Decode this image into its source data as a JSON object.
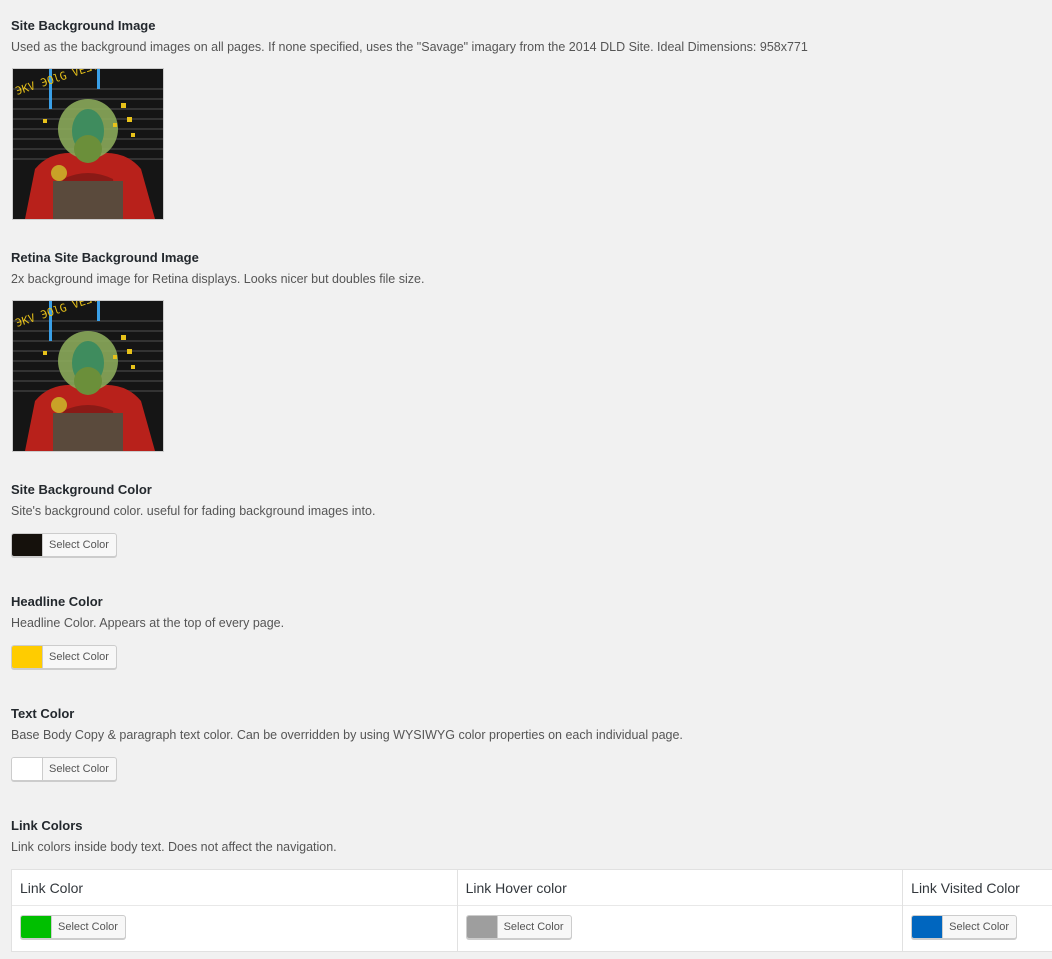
{
  "site_bg_image": {
    "title": "Site Background Image",
    "description": "Used as the background images on all pages. If none specified, uses the \"Savage\" imagary from the 2014 DLD Site. Ideal Dimensions: 958x771"
  },
  "retina_bg_image": {
    "title": "Retina Site Background Image",
    "description": "2x background image for Retina displays. Looks nicer but doubles file size."
  },
  "thumbnail_text": "ЭKV ЭOlG VEƎVИ ЯVD",
  "site_bg_color": {
    "title": "Site Background Color",
    "description": "Site's background color. useful for fading background images into.",
    "swatch": "#15110c",
    "button_label": "Select Color"
  },
  "headline_color": {
    "title": "Headline Color",
    "description": "Headline Color. Appears at the top of every page.",
    "swatch": "#ffcc00",
    "button_label": "Select Color"
  },
  "text_color": {
    "title": "Text Color",
    "description": "Base Body Copy & paragraph text color. Can be overridden by using WYSIWYG color properties on each individual page.",
    "swatch": "#ffffff",
    "button_label": "Select Color"
  },
  "link_colors": {
    "title": "Link Colors",
    "description": "Link colors inside body text. Does not affect the navigation.",
    "columns": [
      {
        "label": "Link Color",
        "swatch": "#00bf00",
        "button_label": "Select Color"
      },
      {
        "label": "Link Hover color",
        "swatch": "#9e9e9e",
        "button_label": "Select Color"
      },
      {
        "label": "Link Visited Color",
        "swatch": "#0066bf",
        "button_label": "Select Color"
      }
    ]
  }
}
